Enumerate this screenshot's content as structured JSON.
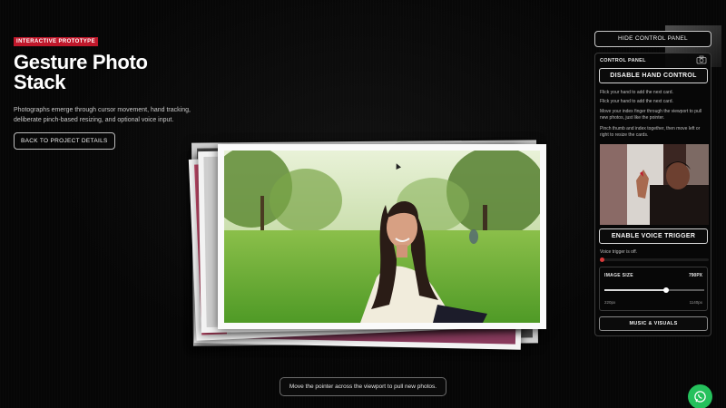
{
  "intro": {
    "badge": "INTERACTIVE PROTOTYPE",
    "title": "Gesture Photo Stack",
    "description": "Photographs emerge through cursor movement, hand tracking, deliberate pinch-based resizing, and optional voice input.",
    "back_button": "BACK TO PROJECT DETAILS"
  },
  "hint": "Move the pointer across the viewport to pull new photos.",
  "control": {
    "hide_button": "HIDE CONTROL PANEL",
    "panel_label": "CONTROL PANEL",
    "hand_button": "DISABLE HAND CONTROL",
    "messages": [
      "Flick your hand to add the next card.",
      "Flick your hand to add the next card.",
      "Move your index finger through the viewport to pull new photos, just like the pointer.",
      "Pinch thumb and index together, then move left or right to resize the cards."
    ],
    "voice_button": "ENABLE VOICE TRIGGER",
    "voice_status": "Voice trigger is off.",
    "image_size": {
      "label": "IMAGE SIZE",
      "value": "790PX",
      "min_label": "220px",
      "max_label": "1140px",
      "level_fraction": 0.62
    },
    "music_button": "MUSIC & VISUALS"
  },
  "colors": {
    "background": "#060606",
    "badge": "#c0182b",
    "whatsapp": "#25c15c",
    "voice_indicator": "#d83a3a"
  },
  "icons": [
    "camera-icon",
    "whatsapp-icon",
    "cursor-icon"
  ]
}
